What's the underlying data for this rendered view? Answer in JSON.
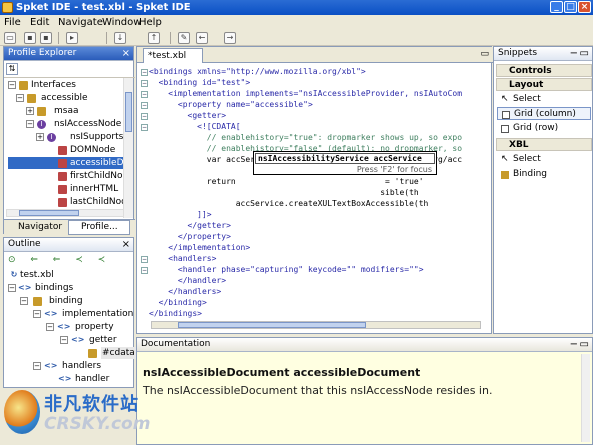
{
  "window": {
    "title": "Spket IDE - test.xbl - Spket IDE"
  },
  "menu": [
    "File",
    "Edit",
    "Navigate",
    "Window",
    "Help"
  ],
  "profile_explorer": {
    "title": "Profile Explorer",
    "items": [
      {
        "label": "Interfaces",
        "icon": "folder-icon"
      },
      {
        "label": "accessible",
        "icon": "package-icon"
      },
      {
        "label": "msaa",
        "icon": "package-icon"
      },
      {
        "label": "nsIAccessNode",
        "icon": "interface-icon"
      },
      {
        "label": "nsISupports",
        "icon": "interface-icon"
      },
      {
        "label": "DOMNode",
        "icon": "field-icon"
      },
      {
        "label": "accessibleDo",
        "icon": "field-icon"
      },
      {
        "label": "firstChildNo",
        "icon": "field-icon"
      },
      {
        "label": "innerHTML",
        "icon": "field-icon"
      },
      {
        "label": "lastChildNod",
        "icon": "field-icon"
      }
    ],
    "tabs": [
      "Navigator",
      "Profile..."
    ]
  },
  "outline": {
    "title": "Outline",
    "items": [
      "test.xbl",
      "bindings",
      "binding",
      "implementation",
      "property",
      "getter",
      "#cdata",
      "handlers",
      "handler"
    ]
  },
  "editor": {
    "tab": "*test.xbl",
    "lines": [
      "<bindings xmlns=\"http://www.mozilla.org/xbl\">",
      "  <binding id=\"test\">",
      "    <implementation implements=\"nsIAccessibleProvider, nsIAutoCom",
      "      <property name=\"accessible\">",
      "        <getter>",
      "          <![CDATA[",
      "            // enablehistory=\"true\": dropmarker shows up, so expo",
      "            // enablehistory=\"false\" (default): no dropmarker, so",
      "            var accService = Components.classes[\"@mozilla.org/acc",
      "                                                faces.ns",
      "            return                               = 'true'",
      "                                                sible(th",
      "                  accService.createXULTextBoxAccessible(th",
      "          ]]>",
      "        </getter>",
      "      </property>",
      "    </implementation>",
      "    <handlers>",
      "      <handler phase=\"capturing\" keycode=\"\" modifiers=\"\">",
      "      </handler>",
      "    </handlers>",
      "  </binding>",
      "</bindings>"
    ],
    "popup": {
      "selected": "nsIAccessibilityService accService",
      "hint": "Press 'F2' for focus"
    }
  },
  "snippets": {
    "title": "Snippets",
    "groups": [
      {
        "name": "Controls",
        "items": []
      },
      {
        "name": "Layout",
        "items": [
          "Select",
          "Grid (column)",
          "Grid (row)"
        ]
      },
      {
        "name": "XBL",
        "items": [
          "Select",
          "Binding"
        ]
      }
    ]
  },
  "documentation": {
    "title": "Documentation",
    "heading": "nsIAccessibleDocument accessibleDocument",
    "text": "The nsIAccessibleDocument that this nsIAccessNode resides in."
  },
  "watermark": {
    "line1": "非凡软件站",
    "line2": "CRSKY.com"
  }
}
